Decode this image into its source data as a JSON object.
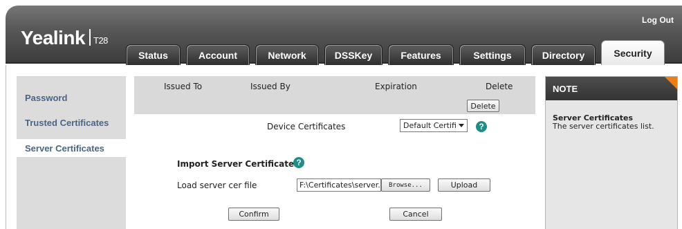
{
  "header": {
    "logo_brand": "Yealink",
    "logo_model": "T28",
    "logout": "Log Out"
  },
  "tabs": [
    {
      "label": "Status",
      "active": false
    },
    {
      "label": "Account",
      "active": false
    },
    {
      "label": "Network",
      "active": false
    },
    {
      "label": "DSSKey",
      "active": false
    },
    {
      "label": "Features",
      "active": false
    },
    {
      "label": "Settings",
      "active": false
    },
    {
      "label": "Directory",
      "active": false
    },
    {
      "label": "Security",
      "active": true
    }
  ],
  "sidebar": {
    "items": [
      {
        "label": "Password",
        "active": false
      },
      {
        "label": "Trusted Certificates",
        "active": false
      },
      {
        "label": "Server Certificates",
        "active": true
      }
    ]
  },
  "certs_table": {
    "headers": [
      "Issued To",
      "Issued By",
      "Expiration",
      "Delete"
    ],
    "delete_button": "Delete"
  },
  "device_certificates": {
    "label": "Device Certificates",
    "selected": "Default Certifi"
  },
  "import": {
    "title": "Import Server Certificates",
    "load_label": "Load server cer file",
    "file_value": "F:\\Certificates\\server.p",
    "browse_button": "Browse...",
    "upload_button": "Upload"
  },
  "actions": {
    "confirm": "Confirm",
    "cancel": "Cancel"
  },
  "note": {
    "heading": "NOTE",
    "title": "Server Certificates",
    "text": "The server certificates list."
  },
  "help_icon_glyph": "?",
  "colors": {
    "accent_orange": "#f07d0f",
    "help_teal": "#1e8e87",
    "sidebar_link": "#4a6584"
  }
}
